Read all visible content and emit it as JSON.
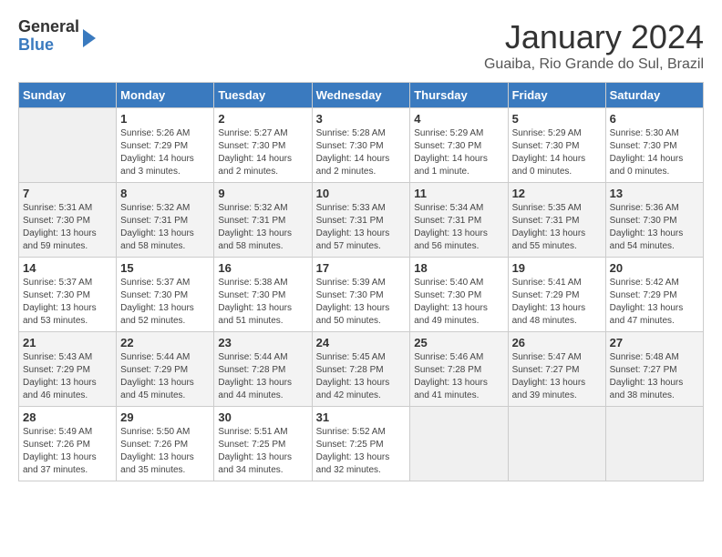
{
  "header": {
    "logo_general": "General",
    "logo_blue": "Blue",
    "title": "January 2024",
    "location": "Guaiba, Rio Grande do Sul, Brazil"
  },
  "days_of_week": [
    "Sunday",
    "Monday",
    "Tuesday",
    "Wednesday",
    "Thursday",
    "Friday",
    "Saturday"
  ],
  "weeks": [
    [
      {
        "day": "",
        "info": ""
      },
      {
        "day": "1",
        "info": "Sunrise: 5:26 AM\nSunset: 7:29 PM\nDaylight: 14 hours\nand 3 minutes."
      },
      {
        "day": "2",
        "info": "Sunrise: 5:27 AM\nSunset: 7:30 PM\nDaylight: 14 hours\nand 2 minutes."
      },
      {
        "day": "3",
        "info": "Sunrise: 5:28 AM\nSunset: 7:30 PM\nDaylight: 14 hours\nand 2 minutes."
      },
      {
        "day": "4",
        "info": "Sunrise: 5:29 AM\nSunset: 7:30 PM\nDaylight: 14 hours\nand 1 minute."
      },
      {
        "day": "5",
        "info": "Sunrise: 5:29 AM\nSunset: 7:30 PM\nDaylight: 14 hours\nand 0 minutes."
      },
      {
        "day": "6",
        "info": "Sunrise: 5:30 AM\nSunset: 7:30 PM\nDaylight: 14 hours\nand 0 minutes."
      }
    ],
    [
      {
        "day": "7",
        "info": "Sunrise: 5:31 AM\nSunset: 7:30 PM\nDaylight: 13 hours\nand 59 minutes."
      },
      {
        "day": "8",
        "info": "Sunrise: 5:32 AM\nSunset: 7:31 PM\nDaylight: 13 hours\nand 58 minutes."
      },
      {
        "day": "9",
        "info": "Sunrise: 5:32 AM\nSunset: 7:31 PM\nDaylight: 13 hours\nand 58 minutes."
      },
      {
        "day": "10",
        "info": "Sunrise: 5:33 AM\nSunset: 7:31 PM\nDaylight: 13 hours\nand 57 minutes."
      },
      {
        "day": "11",
        "info": "Sunrise: 5:34 AM\nSunset: 7:31 PM\nDaylight: 13 hours\nand 56 minutes."
      },
      {
        "day": "12",
        "info": "Sunrise: 5:35 AM\nSunset: 7:31 PM\nDaylight: 13 hours\nand 55 minutes."
      },
      {
        "day": "13",
        "info": "Sunrise: 5:36 AM\nSunset: 7:30 PM\nDaylight: 13 hours\nand 54 minutes."
      }
    ],
    [
      {
        "day": "14",
        "info": "Sunrise: 5:37 AM\nSunset: 7:30 PM\nDaylight: 13 hours\nand 53 minutes."
      },
      {
        "day": "15",
        "info": "Sunrise: 5:37 AM\nSunset: 7:30 PM\nDaylight: 13 hours\nand 52 minutes."
      },
      {
        "day": "16",
        "info": "Sunrise: 5:38 AM\nSunset: 7:30 PM\nDaylight: 13 hours\nand 51 minutes."
      },
      {
        "day": "17",
        "info": "Sunrise: 5:39 AM\nSunset: 7:30 PM\nDaylight: 13 hours\nand 50 minutes."
      },
      {
        "day": "18",
        "info": "Sunrise: 5:40 AM\nSunset: 7:30 PM\nDaylight: 13 hours\nand 49 minutes."
      },
      {
        "day": "19",
        "info": "Sunrise: 5:41 AM\nSunset: 7:29 PM\nDaylight: 13 hours\nand 48 minutes."
      },
      {
        "day": "20",
        "info": "Sunrise: 5:42 AM\nSunset: 7:29 PM\nDaylight: 13 hours\nand 47 minutes."
      }
    ],
    [
      {
        "day": "21",
        "info": "Sunrise: 5:43 AM\nSunset: 7:29 PM\nDaylight: 13 hours\nand 46 minutes."
      },
      {
        "day": "22",
        "info": "Sunrise: 5:44 AM\nSunset: 7:29 PM\nDaylight: 13 hours\nand 45 minutes."
      },
      {
        "day": "23",
        "info": "Sunrise: 5:44 AM\nSunset: 7:28 PM\nDaylight: 13 hours\nand 44 minutes."
      },
      {
        "day": "24",
        "info": "Sunrise: 5:45 AM\nSunset: 7:28 PM\nDaylight: 13 hours\nand 42 minutes."
      },
      {
        "day": "25",
        "info": "Sunrise: 5:46 AM\nSunset: 7:28 PM\nDaylight: 13 hours\nand 41 minutes."
      },
      {
        "day": "26",
        "info": "Sunrise: 5:47 AM\nSunset: 7:27 PM\nDaylight: 13 hours\nand 39 minutes."
      },
      {
        "day": "27",
        "info": "Sunrise: 5:48 AM\nSunset: 7:27 PM\nDaylight: 13 hours\nand 38 minutes."
      }
    ],
    [
      {
        "day": "28",
        "info": "Sunrise: 5:49 AM\nSunset: 7:26 PM\nDaylight: 13 hours\nand 37 minutes."
      },
      {
        "day": "29",
        "info": "Sunrise: 5:50 AM\nSunset: 7:26 PM\nDaylight: 13 hours\nand 35 minutes."
      },
      {
        "day": "30",
        "info": "Sunrise: 5:51 AM\nSunset: 7:25 PM\nDaylight: 13 hours\nand 34 minutes."
      },
      {
        "day": "31",
        "info": "Sunrise: 5:52 AM\nSunset: 7:25 PM\nDaylight: 13 hours\nand 32 minutes."
      },
      {
        "day": "",
        "info": ""
      },
      {
        "day": "",
        "info": ""
      },
      {
        "day": "",
        "info": ""
      }
    ]
  ]
}
